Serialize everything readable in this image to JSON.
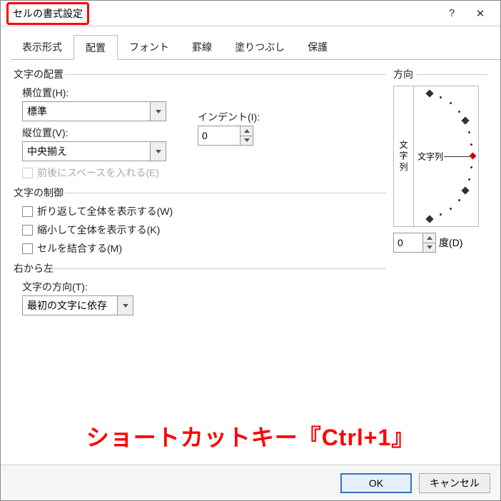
{
  "title": "セルの書式設定",
  "tabs": [
    "表示形式",
    "配置",
    "フォント",
    "罫線",
    "塗りつぶし",
    "保護"
  ],
  "active_tab": 1,
  "alignment": {
    "group_title": "文字の配置",
    "horizontal_label": "横位置(H):",
    "horizontal_value": "標準",
    "vertical_label": "縦位置(V):",
    "vertical_value": "中央揃え",
    "indent_label": "インデント(I):",
    "indent_value": "0",
    "justify_distributed_label": "前後にスペースを入れる(E)"
  },
  "text_control": {
    "group_title": "文字の制御",
    "wrap_label": "折り返して全体を表示する(W)",
    "shrink_label": "縮小して全体を表示する(K)",
    "merge_label": "セルを結合する(M)"
  },
  "rtl": {
    "group_title": "右から左",
    "direction_label": "文字の方向(T):",
    "direction_value": "最初の文字に依存"
  },
  "orientation": {
    "group_title": "方向",
    "vertical_text": "文字列",
    "label_text": "文字列",
    "degree_value": "0",
    "degree_label": "度(D)"
  },
  "footer": {
    "ok": "OK",
    "cancel": "キャンセル"
  },
  "annotation": "ショートカットキー『Ctrl+1』"
}
